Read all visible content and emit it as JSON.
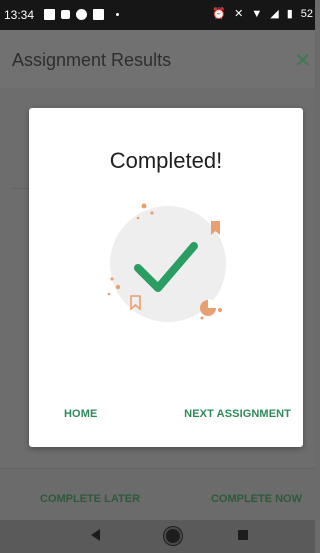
{
  "status_bar": {
    "time": "13:34",
    "battery": "52",
    "icons": [
      "image-icon",
      "sim-icon",
      "app-icon",
      "square-icon",
      "dot-icon",
      "alarm-icon",
      "vibrate-off-icon",
      "wifi-icon",
      "signal-icon",
      "battery-icon"
    ]
  },
  "app_bar": {
    "title": "Assignment Results",
    "close_label": "✕"
  },
  "dialog": {
    "title": "Completed!",
    "illustration": "checkmark-celebration-icon",
    "home_label": "HOME",
    "next_label": "NEXT ASSIGNMENT"
  },
  "bottom_bar": {
    "later_label": "COMPLETE LATER",
    "now_label": "COMPLETE NOW"
  },
  "nav_bar": {
    "items": [
      "back-icon",
      "home-icon",
      "recents-icon"
    ]
  },
  "colors": {
    "accent": "#2f8a5a",
    "check": "#2a9d63",
    "illustration_orange": "#e8a070",
    "scrim": "#6b6b6b"
  }
}
